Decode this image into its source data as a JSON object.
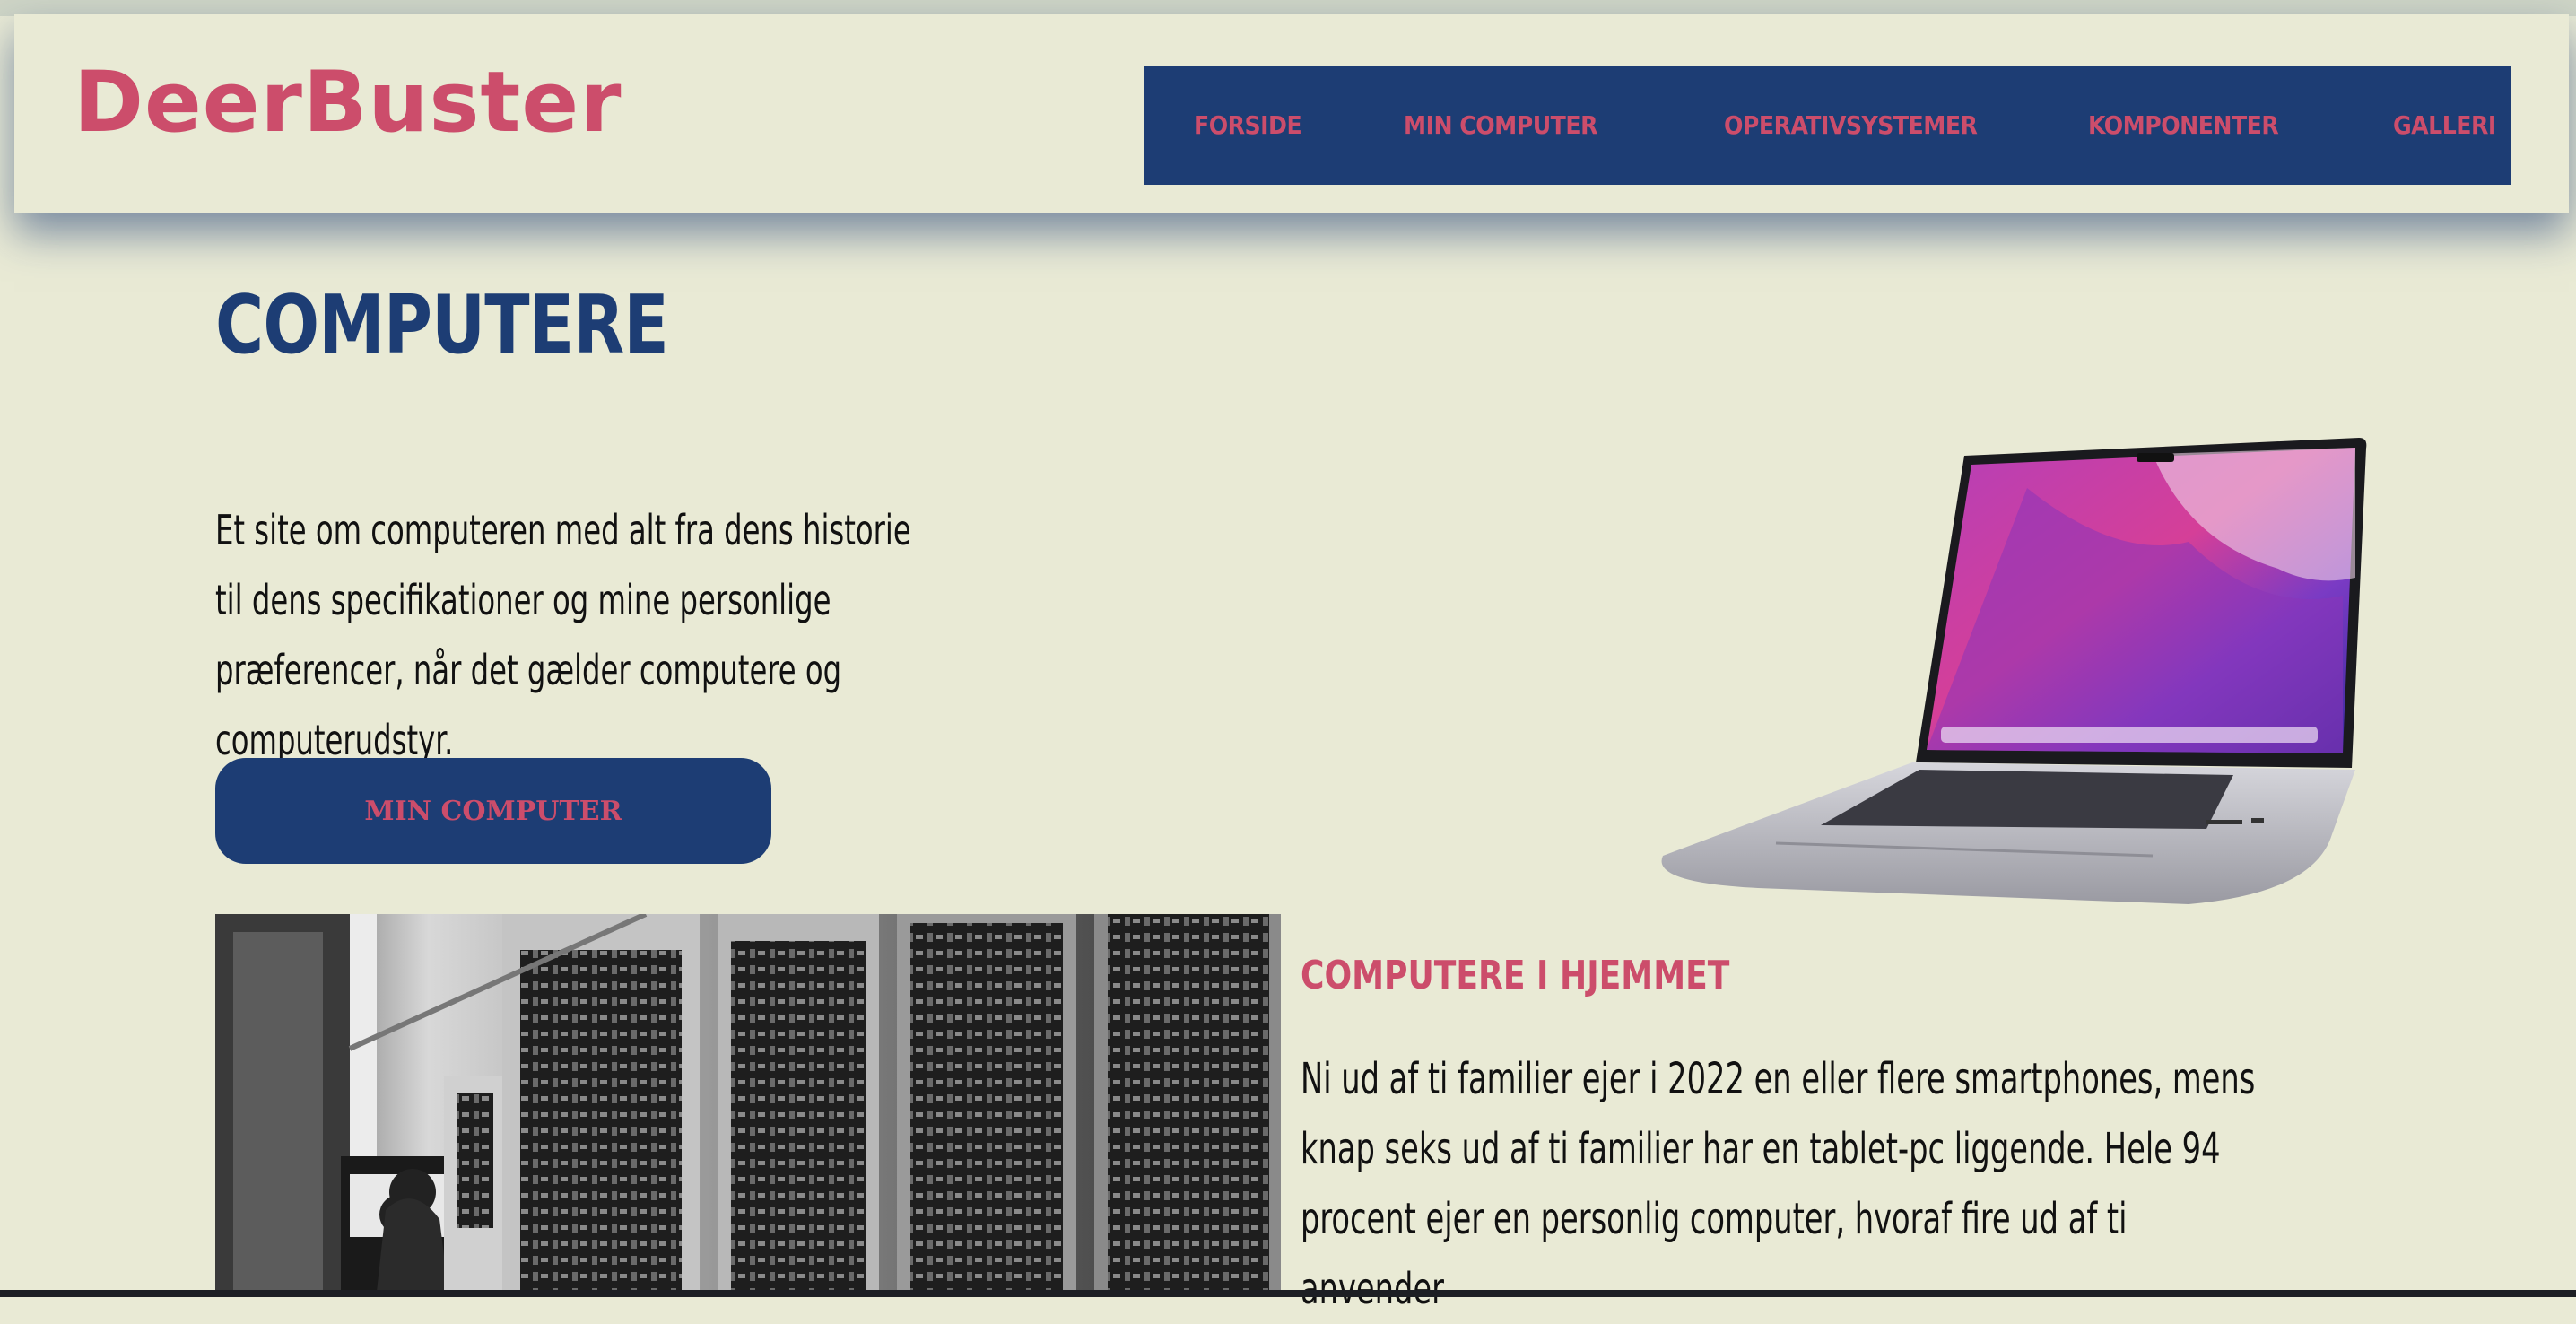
{
  "brand": {
    "logo": "DeerBuster"
  },
  "nav": {
    "items": [
      {
        "label": "FORSIDE"
      },
      {
        "label": "MIN COMPUTER"
      },
      {
        "label": "OPERATIVSYSTEMER"
      },
      {
        "label": "KOMPONENTER"
      },
      {
        "label": "GALLERI"
      }
    ]
  },
  "hero": {
    "title": "COMPUTERE",
    "intro": "Et site om computeren med alt fra dens historie til dens specifikationer og mine personlige præferencer, når det gælder computere og computerudstyr.",
    "button_label": "MIN COMPUTER"
  },
  "section": {
    "title": "COMPUTERE I HJEMMET",
    "text": "Ni ud af ti familier ejer i 2022 en eller flere smartphones, mens knap seks ud af ti familier har en tablet-pc liggende. Hele 94 procent ejer en personlig computer, hvoraf fire ud af ti anvender"
  },
  "images": {
    "laptop": "laptop-image",
    "history": "vintage-computer-photo"
  },
  "colors": {
    "background": "#e9ead5",
    "navy": "#1d3d74",
    "accent": "#cc4d6b"
  }
}
